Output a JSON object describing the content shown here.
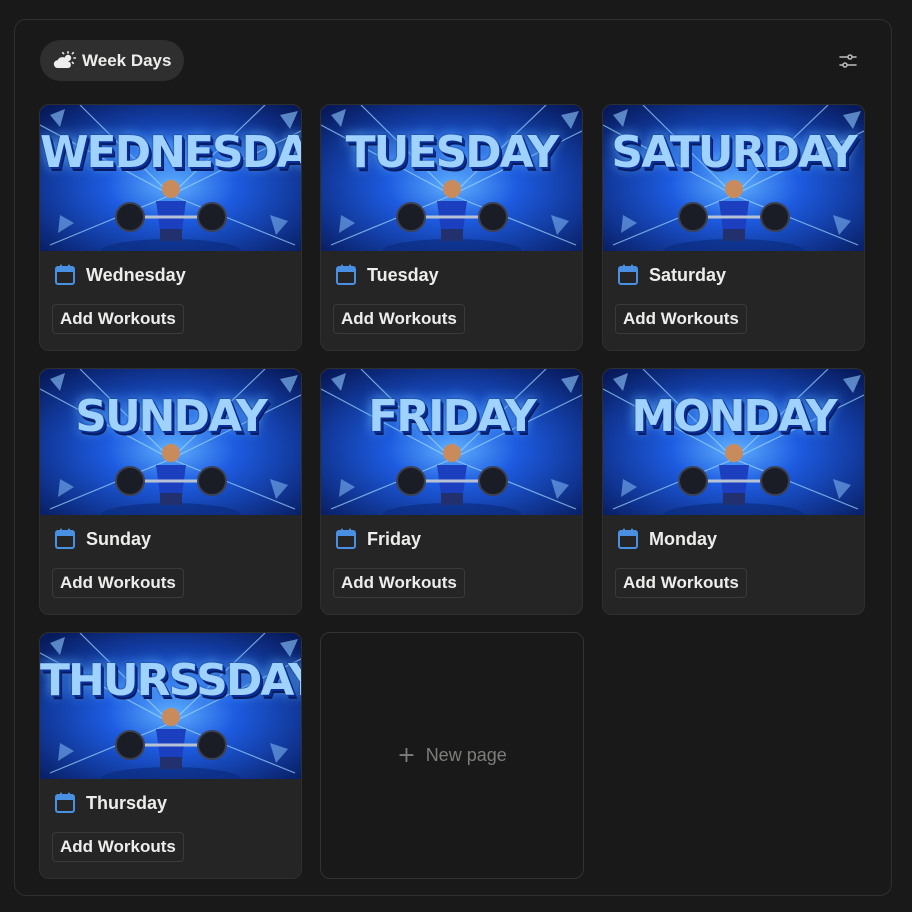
{
  "view": {
    "label": "Week Days",
    "icon": "cloud-sun-icon"
  },
  "filter": {
    "icon": "sliders-icon"
  },
  "colors": {
    "accent": "#4a90e2",
    "card_bg": "#252525",
    "page_bg": "#191919",
    "cover_blue": "#1d5be0"
  },
  "cards": [
    {
      "name": "Wednesday",
      "cover_text": "WEDNESDAY",
      "button": "Add Workouts"
    },
    {
      "name": "Tuesday",
      "cover_text": "TUESDAY",
      "button": "Add Workouts"
    },
    {
      "name": "Saturday",
      "cover_text": "SATURDAY",
      "button": "Add Workouts"
    },
    {
      "name": "Sunday",
      "cover_text": "SUNDAY",
      "button": "Add Workouts"
    },
    {
      "name": "Friday",
      "cover_text": "FRIDAY",
      "button": "Add Workouts"
    },
    {
      "name": "Monday",
      "cover_text": "MONDAY",
      "button": "Add Workouts"
    },
    {
      "name": "Thursday",
      "cover_text": "THURSSDAY",
      "button": "Add Workouts"
    }
  ],
  "new_page": {
    "label": "New page",
    "icon": "plus-icon"
  }
}
